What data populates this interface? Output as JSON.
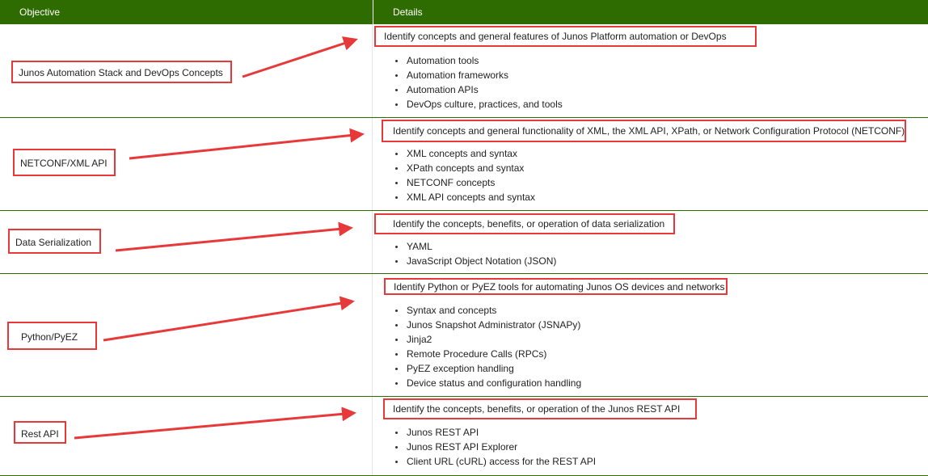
{
  "header": {
    "objective_label": "Objective",
    "details_label": "Details"
  },
  "rows": [
    {
      "objective": "Junos Automation Stack and DevOps Concepts",
      "summary": "Identify concepts and general features of Junos Platform automation or DevOps",
      "bullets": [
        "Automation tools",
        "Automation frameworks",
        "Automation APIs",
        "DevOps culture, practices, and tools"
      ]
    },
    {
      "objective": "NETCONF/XML API",
      "summary": "Identify concepts and general functionality of XML, the XML API, XPath, or Network Configuration Protocol (NETCONF)",
      "bullets": [
        "XML concepts and syntax",
        "XPath concepts and syntax",
        "NETCONF concepts",
        "XML API concepts and syntax"
      ]
    },
    {
      "objective": "Data Serialization",
      "summary": "Identify the concepts, benefits, or operation of data serialization",
      "bullets": [
        "YAML",
        "JavaScript Object Notation (JSON)"
      ]
    },
    {
      "objective": "Python/PyEZ",
      "summary": "Identify Python or PyEZ tools for automating Junos OS devices and networks",
      "bullets": [
        "Syntax and concepts",
        "Junos Snapshot Administrator (JSNAPy)",
        "Jinja2",
        "Remote Procedure Calls (RPCs)",
        "PyEZ exception handling",
        "Device status and configuration handling"
      ]
    },
    {
      "objective": "Rest API",
      "summary": "Identify the concepts, benefits, or operation of the Junos REST API",
      "bullets": [
        "Junos REST API",
        "Junos REST API Explorer",
        "Client URL (cURL) access for the REST API"
      ]
    }
  ],
  "colors": {
    "header_bg": "#2e6b00",
    "annotation_red": "#e8393a"
  }
}
